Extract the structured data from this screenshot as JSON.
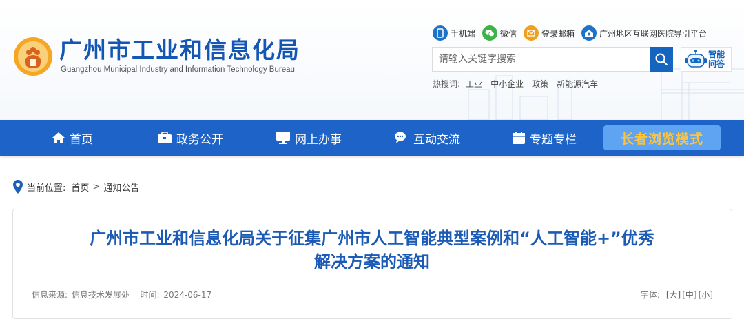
{
  "site": {
    "title": "广州市工业和信息化局",
    "subtitle": "Guangzhou Municipal Industry and Information Technology Bureau"
  },
  "top_links": [
    {
      "label": "手机端",
      "icon": "phone-icon"
    },
    {
      "label": "微信",
      "icon": "wechat-icon"
    },
    {
      "label": "登录邮箱",
      "icon": "mail-icon"
    },
    {
      "label": "广州地区互联网医院导引平台",
      "icon": "hospital-icon"
    }
  ],
  "search": {
    "placeholder": "请输入关键字搜索",
    "value": ""
  },
  "ai": {
    "label_line1": "智能",
    "label_line2": "问答"
  },
  "hot": {
    "label": "热搜词:",
    "items": [
      "工业",
      "中小企业",
      "政策",
      "新能源汽车"
    ]
  },
  "nav": {
    "items": [
      {
        "label": "首页",
        "icon": "home-icon"
      },
      {
        "label": "政务公开",
        "icon": "briefcase-icon"
      },
      {
        "label": "网上办事",
        "icon": "monitor-icon"
      },
      {
        "label": "互动交流",
        "icon": "chat-icon"
      },
      {
        "label": "专题专栏",
        "icon": "calendar-icon"
      }
    ],
    "elder_mode": "长者浏览模式"
  },
  "breadcrumb": {
    "label": "当前位置:",
    "items": [
      "首页",
      "通知公告"
    ],
    "separator": ">"
  },
  "article": {
    "title_line1": "广州市工业和信息化局关于征集广州市人工智能典型案例和“人工智能+”优秀",
    "title_line2": "解决方案的通知",
    "source_label": "信息来源:",
    "source": "信息技术发展处",
    "time_label": "时间:",
    "time": "2024-06-17",
    "font_label": "字体:",
    "font_sizes": [
      "[大]",
      "[中]",
      "[小]"
    ]
  },
  "colors": {
    "brand_blue": "#1e64c8",
    "title_blue": "#1c5bb5",
    "elder_text": "#ffc43a"
  }
}
